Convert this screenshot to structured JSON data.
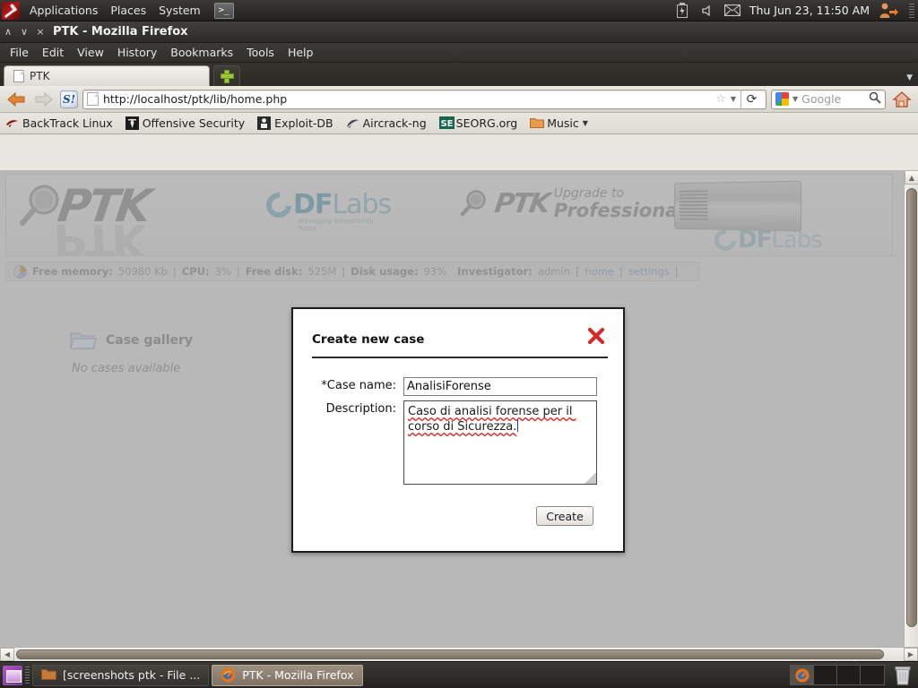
{
  "desktop": {
    "top_panel": {
      "logo": "backtrack-logo",
      "menus": [
        "Applications",
        "Places",
        "System"
      ],
      "terminal_launcher": ">_",
      "tray": [
        "battery-icon",
        "volume-icon",
        "mail-icon"
      ],
      "clock": "Thu Jun 23, 11:50 AM",
      "user_switcher": "user-logout-icon"
    },
    "taskbar": {
      "show_desktop": "show-desktop-icon",
      "tasks": [
        {
          "label": "[screenshots ptk - File ...",
          "icon": "folder-icon",
          "active": false
        },
        {
          "label": "PTK - Mozilla Firefox",
          "icon": "firefox-icon",
          "active": true
        }
      ],
      "workspaces": [
        "1",
        "2",
        "3",
        "4"
      ],
      "current_workspace": 1,
      "trash": "trash-icon"
    }
  },
  "browser": {
    "window_title": "PTK - Mozilla Firefox",
    "window_buttons": {
      "minimize": "∧",
      "maximize": "∨",
      "close": "×"
    },
    "menu": [
      {
        "label": "File",
        "accel": "F"
      },
      {
        "label": "Edit",
        "accel": "E"
      },
      {
        "label": "View",
        "accel": "V"
      },
      {
        "label": "History",
        "accel": "s"
      },
      {
        "label": "Bookmarks",
        "accel": "B"
      },
      {
        "label": "Tools",
        "accel": "T"
      },
      {
        "label": "Help",
        "accel": "H"
      }
    ],
    "tabs": [
      {
        "label": "PTK",
        "active": true
      }
    ],
    "new_tab_label": "+",
    "toolbar": {
      "back": "back-arrow-icon",
      "forward": "forward-arrow-icon",
      "stumbleupon": "S!",
      "url": "http://localhost/ptk/lib/home.php",
      "star": "☆",
      "reload": "⟳",
      "search_engine": "Google",
      "search_placeholder": "Google",
      "home": "home-icon"
    },
    "bookmarks": [
      {
        "label": "BackTrack Linux",
        "icon": "backtrack-icon"
      },
      {
        "label": "Offensive Security",
        "icon": "offsec-icon"
      },
      {
        "label": "Exploit-DB",
        "icon": "exploitdb-icon"
      },
      {
        "label": "Aircrack-ng",
        "icon": "aircrack-icon"
      },
      {
        "label": "SEORG.org",
        "icon": "seorg-icon"
      },
      {
        "label": "Music",
        "icon": "folder-icon",
        "has_menu": true
      }
    ]
  },
  "page": {
    "brand": {
      "ptk_logo": "PTK",
      "dflabs": "DF",
      "dflabs_suffix": "Labs",
      "dflabs_tagline": "Managing Infosecurity Risks",
      "upgrade_line1": "Upgrade to",
      "upgrade_line2": "Professional"
    },
    "status": {
      "free_memory_label": "Free memory:",
      "free_memory_value": "50980 Kb",
      "cpu_label": "CPU:",
      "cpu_value": "3%",
      "free_disk_label": "Free disk:",
      "free_disk_value": "525M",
      "disk_usage_label": "Disk usage:",
      "disk_usage_value": "93%",
      "investigator_label": "Investigator:",
      "investigator_value": "admin",
      "home_link": "home",
      "settings_link": "settings",
      "sep": "|"
    },
    "gallery": {
      "title": "Case gallery",
      "empty_text": "No cases available"
    }
  },
  "modal": {
    "title": "Create new case",
    "close_label": "✖",
    "case_name_label": "*Case name:",
    "case_name_value": "AnalisiForense",
    "description_label": "Description:",
    "description_value": "Caso di analisi forense per il corso di Sicurezza.",
    "create_button": "Create"
  },
  "scrollbars": {
    "up_arrow": "▲",
    "down_arrow": "▼",
    "left_arrow": "◀",
    "right_arrow": "▶"
  },
  "colors": {
    "panel_bg": "#2e2d2a",
    "accent_green": "#9cc93a",
    "dflabs_blue": "#5a9fb8",
    "close_red": "#d42a2a",
    "caret_blue": "#0040ff",
    "spellcheck_red": "#e01b1b",
    "taskbar_active": "#9d8f80"
  }
}
